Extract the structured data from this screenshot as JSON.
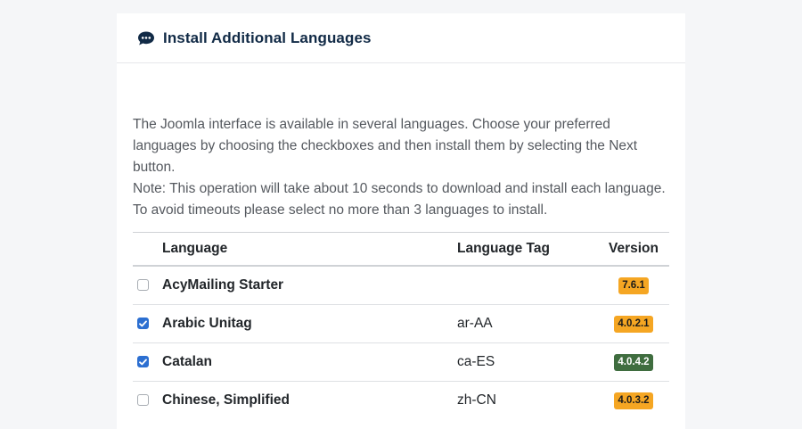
{
  "header": {
    "icon": "comment-dots-icon",
    "title": "Install Additional Languages"
  },
  "description": {
    "line1": "The Joomla interface is available in several languages. Choose your preferred languages by choosing the checkboxes and then install them by selecting the Next button.",
    "line2": "Note: This operation will take about 10 seconds to download and install each language. To avoid timeouts please select no more than 3 languages to install."
  },
  "table": {
    "columns": {
      "language": "Language",
      "tag": "Language Tag",
      "version": "Version"
    },
    "rows": [
      {
        "checked": false,
        "language": "AcyMailing Starter",
        "tag": "",
        "version": "7.6.1",
        "badge_color": "#f5a623"
      },
      {
        "checked": true,
        "language": "Arabic Unitag",
        "tag": "ar-AA",
        "version": "4.0.2.1",
        "badge_color": "#f5a623"
      },
      {
        "checked": true,
        "language": "Catalan",
        "tag": "ca-ES",
        "version": "4.0.4.2",
        "badge_color": "#3f6d3f"
      },
      {
        "checked": false,
        "language": "Chinese, Simplified",
        "tag": "zh-CN",
        "version": "4.0.3.2",
        "badge_color": "#f5a623"
      }
    ]
  },
  "colors": {
    "title": "#112a46",
    "checkbox_checked": "#2c6fd1",
    "badge_warning": "#f5a623",
    "badge_success": "#3f6d3f"
  }
}
